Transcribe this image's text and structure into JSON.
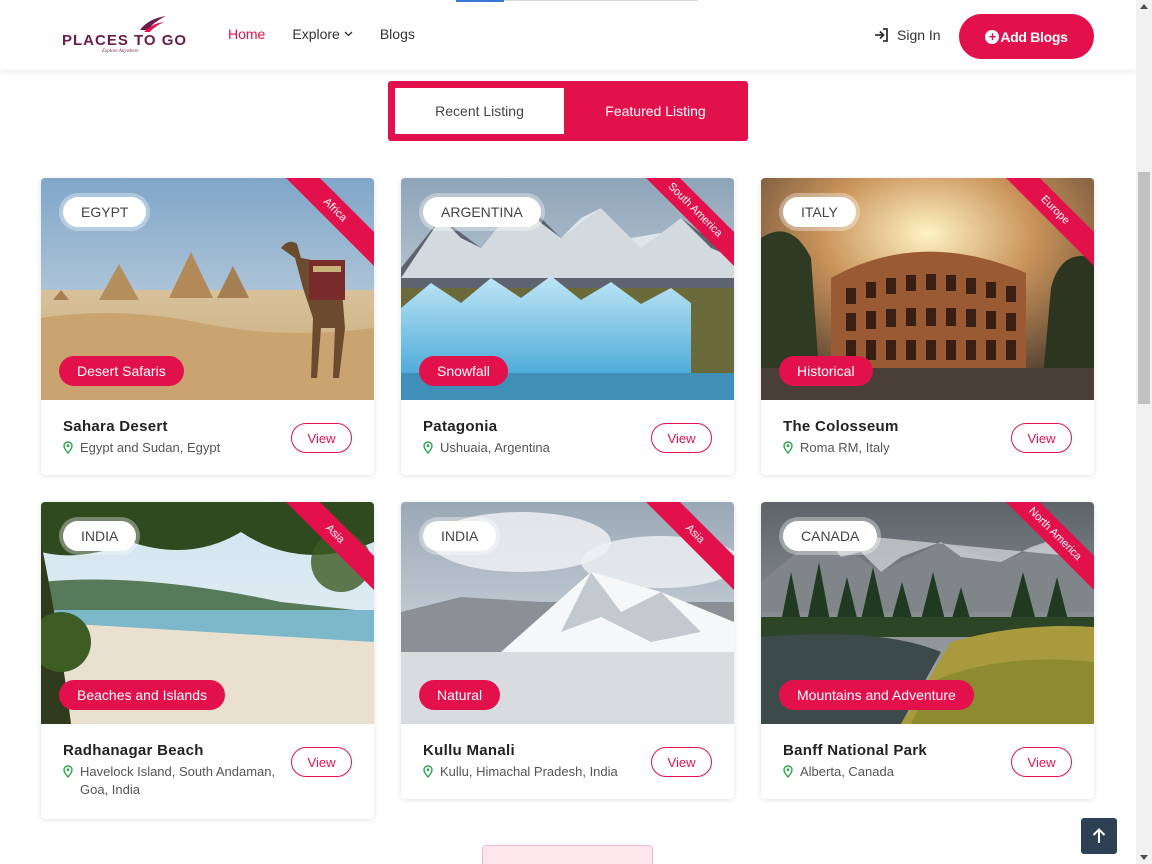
{
  "header": {
    "logo_text": "PLACES TO GO",
    "logo_tagline": "Explore Anywhere",
    "nav": [
      {
        "label": "Home",
        "active": true
      },
      {
        "label": "Explore",
        "active": false,
        "has_dropdown": true
      },
      {
        "label": "Blogs",
        "active": false
      }
    ],
    "sign_in_label": "Sign In",
    "add_blogs_label": "Add Blogs"
  },
  "tabs": {
    "recent_label": "Recent Listing",
    "featured_label": "Featured Listing"
  },
  "listings": [
    {
      "country": "EGYPT",
      "region": "Africa",
      "category": "Desert Safaris",
      "title": "Sahara Desert",
      "location": "Egypt and Sudan, Egypt",
      "view_label": "View"
    },
    {
      "country": "ARGENTINA",
      "region": "South America",
      "category": "Snowfall",
      "title": "Patagonia",
      "location": "Ushuaia, Argentina",
      "view_label": "View"
    },
    {
      "country": "ITALY",
      "region": "Europe",
      "category": "Historical",
      "title": "The Colosseum",
      "location": "Roma RM, Italy",
      "view_label": "View"
    },
    {
      "country": "INDIA",
      "region": "Asia",
      "category": "Beaches and Islands",
      "title": "Radhanagar Beach",
      "location": "Havelock Island, South Andaman, Goa, India",
      "view_label": "View"
    },
    {
      "country": "INDIA",
      "region": "Asia",
      "category": "Natural",
      "title": "Kullu Manali",
      "location": "Kullu, Himachal Pradesh, India",
      "view_label": "View"
    },
    {
      "country": "CANADA",
      "region": "North America",
      "category": "Mountains and Adventure",
      "title": "Banff National Park",
      "location": "Alberta, Canada",
      "view_label": "View"
    }
  ],
  "colors": {
    "accent": "#e3114b",
    "brand": "#6b1d4a",
    "back_to_top": "#2e4053"
  },
  "icons": {
    "sign_in": "sign-in-icon",
    "add": "plus-circle-icon",
    "location": "map-pin-icon",
    "back_to_top": "arrow-up-icon"
  }
}
